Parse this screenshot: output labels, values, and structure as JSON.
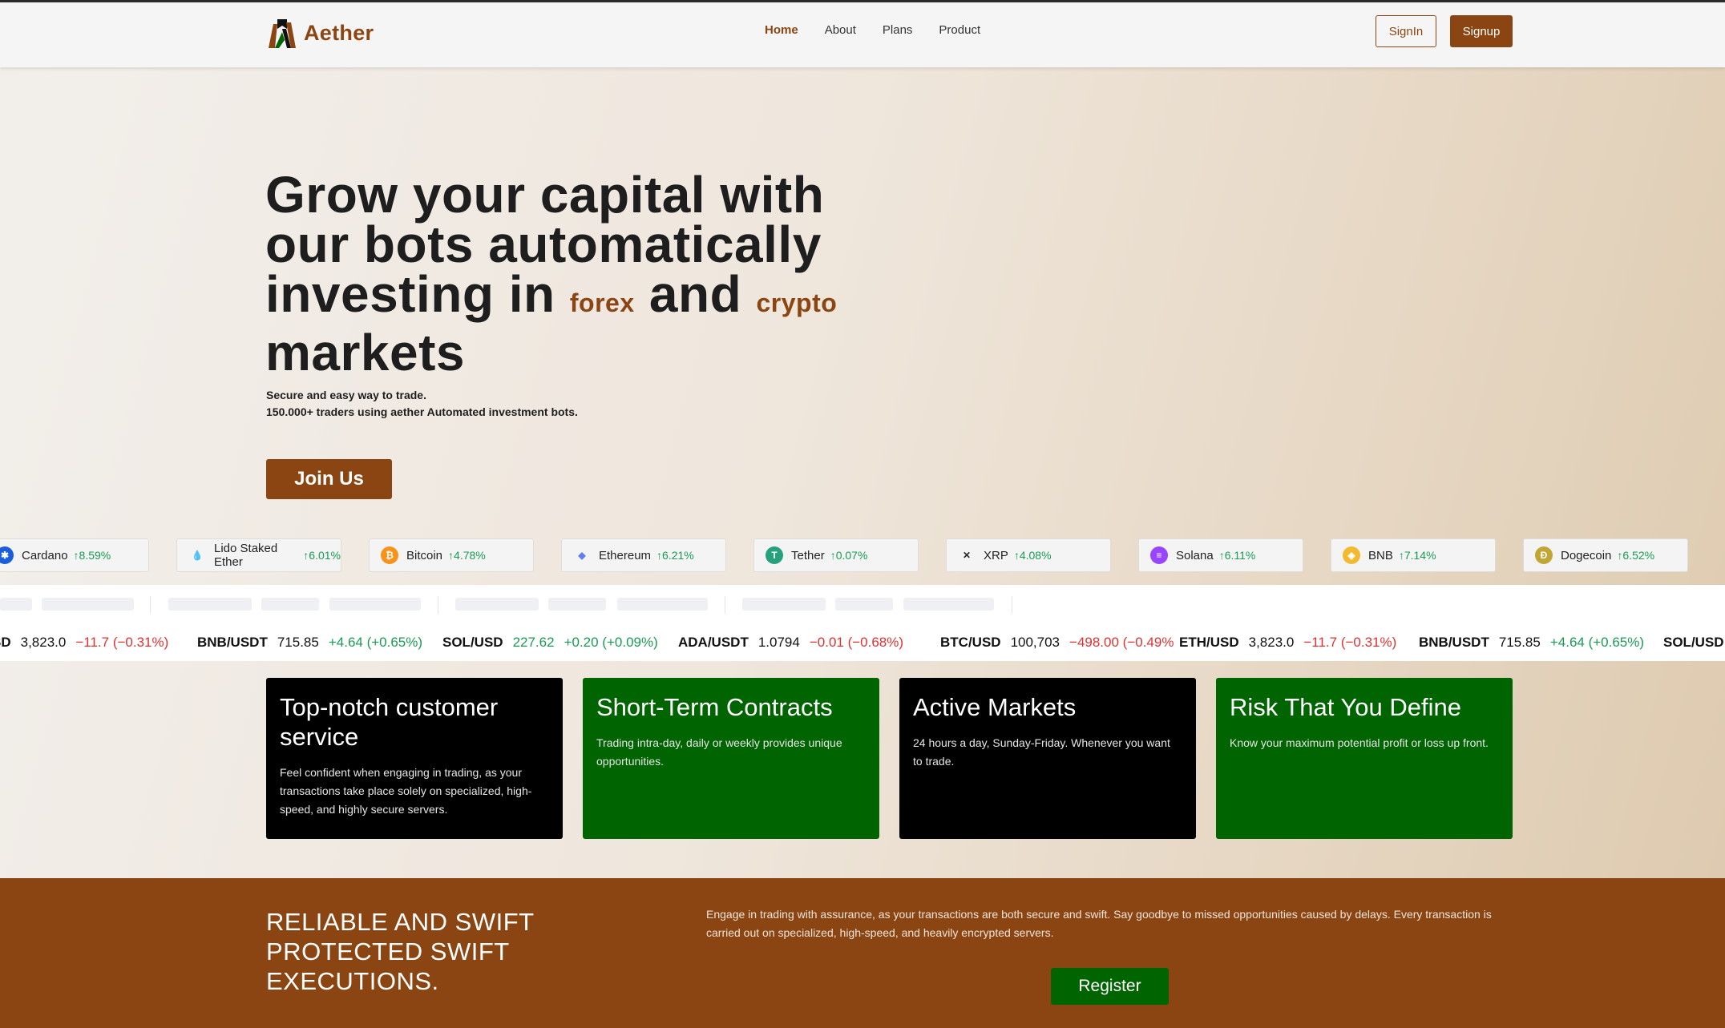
{
  "brand": {
    "name": "Aether",
    "logo_icon": "aether-logo-icon"
  },
  "nav": {
    "links": [
      {
        "label": "Home",
        "active": true
      },
      {
        "label": "About",
        "active": false
      },
      {
        "label": "Plans",
        "active": false
      },
      {
        "label": "Product",
        "active": false
      }
    ],
    "signin_label": "SignIn",
    "signup_label": "Signup"
  },
  "hero": {
    "title_part1": "Grow your capital with our bots automatically investing in",
    "highlight1": "forex",
    "and_word": "and",
    "highlight2": "crypto",
    "title_part2": "markets",
    "subtitle_line1": "Secure and easy way to trade.",
    "subtitle_line2": "150.000+ traders using aether Automated investment bots.",
    "cta_label": "Join Us"
  },
  "coins": [
    {
      "name": "Cardano",
      "change": "↑8.59%",
      "icon": "cardano-icon",
      "color": "#1b5edb"
    },
    {
      "name": "Lido Staked Ether",
      "change": "↑6.01%",
      "icon": "lido-icon",
      "color": "#3aa4f5"
    },
    {
      "name": "Bitcoin",
      "change": "↑4.78%",
      "icon": "bitcoin-icon",
      "color": "#f7931a"
    },
    {
      "name": "Ethereum",
      "change": "↑6.21%",
      "icon": "ethereum-icon",
      "color": "#627eea"
    },
    {
      "name": "Tether",
      "change": "↑0.07%",
      "icon": "tether-icon",
      "color": "#26a17b"
    },
    {
      "name": "XRP",
      "change": "↑4.08%",
      "icon": "xrp-icon",
      "color": "#23292f"
    },
    {
      "name": "Solana",
      "change": "↑6.11%",
      "icon": "solana-icon",
      "color": "#9945ff"
    },
    {
      "name": "BNB",
      "change": "↑7.14%",
      "icon": "bnb-icon",
      "color": "#f3ba2f"
    },
    {
      "name": "Dogecoin",
      "change": "↑6.52%",
      "icon": "dogecoin-icon",
      "color": "#c2a633"
    }
  ],
  "ticker": [
    {
      "symbol": "SD",
      "price": "3,823.0",
      "change": "−11.7 (−0.31%)",
      "positive": false
    },
    {
      "symbol": "BNB/USDT",
      "price": "715.85",
      "change": "+4.64 (+0.65%)",
      "positive": true
    },
    {
      "symbol": "SOL/USD",
      "price": "227.62",
      "change": "+0.20 (+0.09%)",
      "positive": true
    },
    {
      "symbol": "ADA/USDT",
      "price": "1.0794",
      "change": "−0.01 (−0.68%)",
      "positive": false
    },
    {
      "symbol": "BTC/USD",
      "price": "100,703",
      "change": "−498.00 (−0.49%",
      "positive": false
    },
    {
      "symbol": "ETH/USD",
      "price": "3,823.0",
      "change": "−11.7 (−0.31%)",
      "positive": false
    },
    {
      "symbol": "BNB/USDT",
      "price": "715.85",
      "change": "+4.64 (+0.65%)",
      "positive": true
    },
    {
      "symbol": "SOL/USD",
      "price": "",
      "change": "",
      "positive": true
    }
  ],
  "features": [
    {
      "title": "Top-notch customer service",
      "text": "Feel confident when engaging in trading, as your transactions take place solely on specialized, high-speed, and highly secure servers.",
      "theme": "black"
    },
    {
      "title": "Short-Term Contracts",
      "text": "Trading intra-day, daily or weekly provides unique opportunities.",
      "theme": "green"
    },
    {
      "title": "Active Markets",
      "text": "24 hours a day, Sunday-Friday. Whenever you want to trade.",
      "theme": "black"
    },
    {
      "title": "Risk That You Define",
      "text": "Know your maximum potential profit or loss up front.",
      "theme": "green"
    }
  ],
  "bottom": {
    "title": "RELIABLE AND SWIFT PROTECTED SWIFT EXECUTIONS.",
    "text": "Engage in trading with assurance, as your transactions are both secure and swift. Say goodbye to missed opportunities caused by delays. Every transaction is carried out on specialized, high-speed, and heavily encrypted servers.",
    "cta_label": "Register"
  },
  "colors": {
    "brand": "#8b4513",
    "green": "#006400",
    "positive": "#1a9a55",
    "negative": "#e03131"
  }
}
